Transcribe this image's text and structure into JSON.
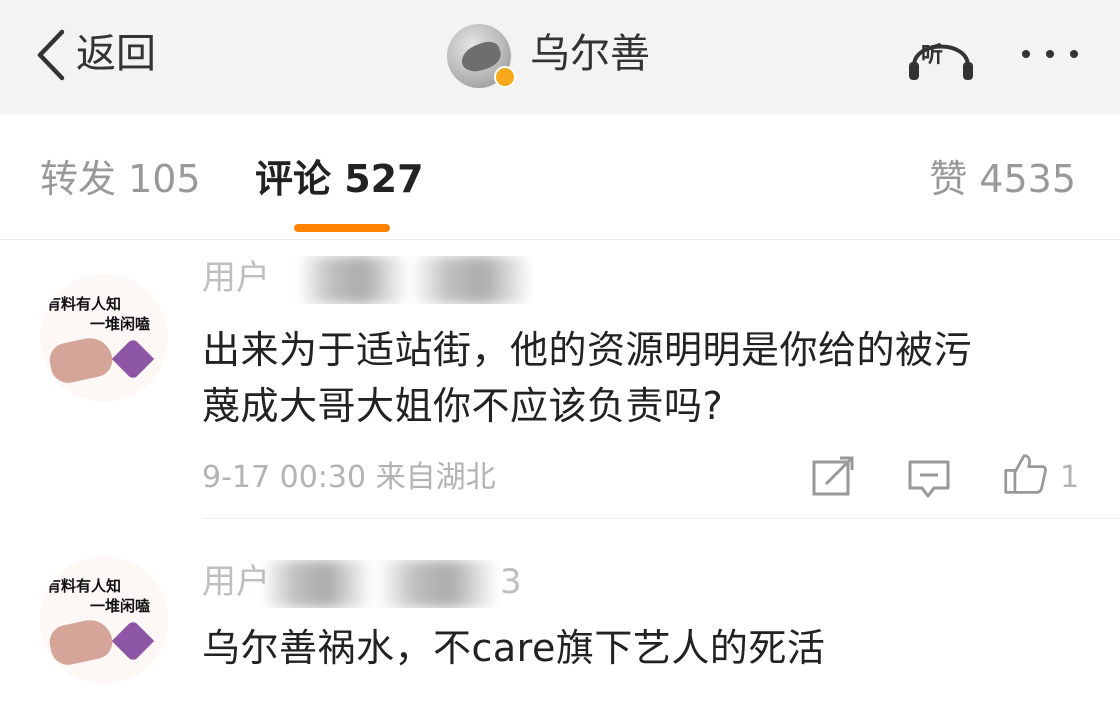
{
  "header": {
    "back_label": "返回",
    "author_name": "乌尔善",
    "listen_label": "听",
    "icons": {
      "back": "chevron-left-icon",
      "listen": "headphones-icon",
      "more": "more-dots-icon",
      "verified": "verified-badge-icon"
    }
  },
  "tabs": {
    "reposts": "转发 105",
    "comments": "评论 527",
    "likes": "赞 4535",
    "active": "comments",
    "accent_color": "#ff8200"
  },
  "comments": [
    {
      "avatar_text_line1": "有料有人知",
      "avatar_text_line2": "一堆闲嗑",
      "username": "用户",
      "text_line1": "出来为于适站街，他的资源明明是你给的被污",
      "text_line2": "蔑成大哥大姐你不应该负责吗?",
      "meta": "9-17 00:30 来自湖北",
      "like_count": "1"
    },
    {
      "avatar_text_line1": "有料有人知",
      "avatar_text_line2": "一堆闲嗑",
      "username": "用户",
      "username_tail": "3",
      "text_line1": "乌尔善祸水，不care旗下艺人的死活"
    }
  ]
}
